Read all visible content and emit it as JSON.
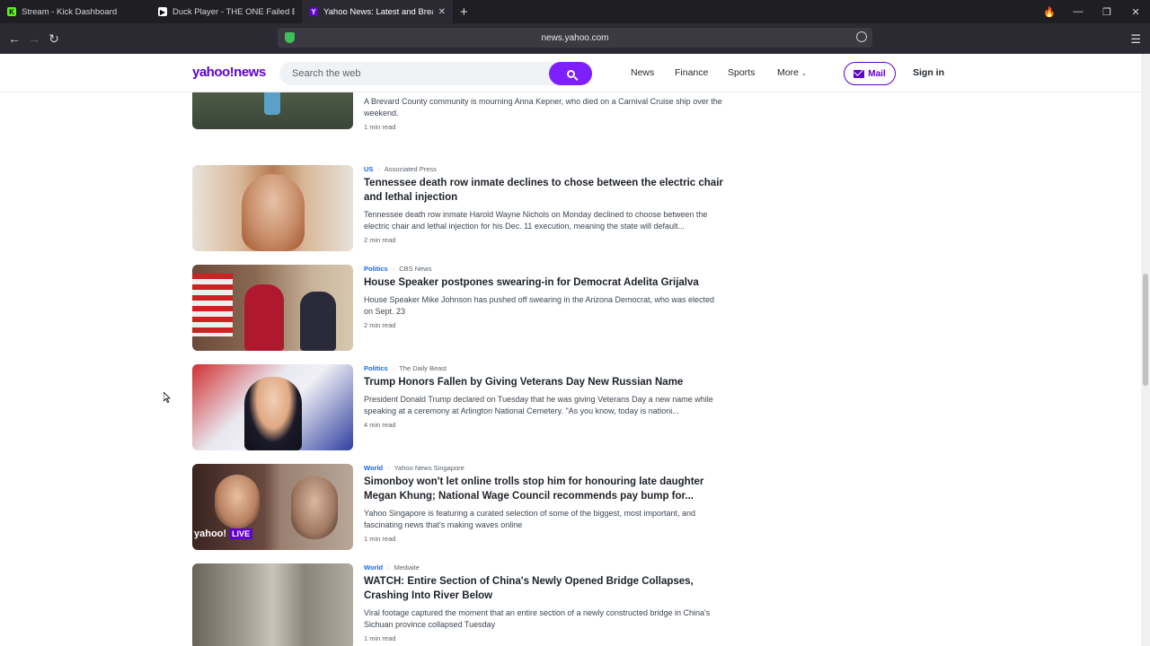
{
  "browser": {
    "tabs": [
      {
        "title": "Stream - Kick Dashboard",
        "favicon": "K",
        "color": "#53fc18"
      },
      {
        "title": "Duck Player - THE ONE Failed Be",
        "favicon": "▶",
        "color": "#ffffff"
      },
      {
        "title": "Yahoo News: Latest and Break",
        "favicon": "Y",
        "color": "#6001d2"
      }
    ],
    "url": "news.yahoo.com"
  },
  "header": {
    "logo": "yahoo!news",
    "search_placeholder": "Search the web",
    "nav": [
      "News",
      "Finance",
      "Sports",
      "More"
    ],
    "mail": "Mail",
    "signin": "Sign in"
  },
  "articles": [
    {
      "category": "",
      "source": "",
      "headline": "",
      "summary": "A Brevard County community is mourning Anna Kepner, who died on a Carnival Cruise ship over the weekend.",
      "readtime": "1 min read",
      "thumb_colors": [
        "#6d7a5c",
        "#3d4a3a"
      ]
    },
    {
      "category": "US",
      "source": "Associated Press",
      "headline": "Tennessee death row inmate declines to chose between the electric chair and lethal injection",
      "summary": "Tennessee death row inmate Harold Wayne Nichols on Monday declined to choose between the electric chair and lethal injection for his Dec. 11 execution, meaning the state will default...",
      "readtime": "2 min read",
      "thumb_colors": [
        "#c9a27e",
        "#8a5a3a"
      ]
    },
    {
      "category": "Politics",
      "source": "CBS News",
      "headline": "House Speaker postpones swearing-in for Democrat Adelita Grijalva",
      "summary": "House Speaker Mike Johnson has pushed off swearing in the Arizona Democrat, who was elected on Sept. 23",
      "readtime": "2 min read",
      "thumb_colors": [
        "#b02030",
        "#3a3550"
      ]
    },
    {
      "category": "Politics",
      "source": "The Daily Beast",
      "headline": "Trump Honors Fallen by Giving Veterans Day New Russian Name",
      "summary": "President Donald Trump declared on Tuesday that he was giving Veterans Day a new name while speaking at a ceremony at Arlington National Cemetery. \"As you know, today is nationi...",
      "readtime": "4 min read",
      "thumb_colors": [
        "#c42a2a",
        "#2b3a80"
      ]
    },
    {
      "category": "World",
      "source": "Yahoo News Singapore",
      "headline": "Simonboy won't let online trolls stop him for honouring late daughter Megan Khung; National Wage Council recommends pay bump for...",
      "summary": "Yahoo Singapore is featuring a curated selection of some of the biggest, most important, and fascinating news that's making waves online",
      "readtime": "1 min read",
      "thumb_colors": [
        "#4a2a28",
        "#8a6a58"
      ],
      "live_label": "yahoo!",
      "live_badge": "LIVE"
    },
    {
      "category": "World",
      "source": "Mediaite",
      "headline": "WATCH: Entire Section of China's Newly Opened Bridge Collapses, Crashing Into River Below",
      "summary": "Viral footage captured the moment that an entire section of a newly constructed bridge in China's Sichuan province collapsed Tuesday",
      "readtime": "1 min read",
      "thumb_colors": [
        "#9a9488",
        "#5a554c"
      ]
    }
  ]
}
